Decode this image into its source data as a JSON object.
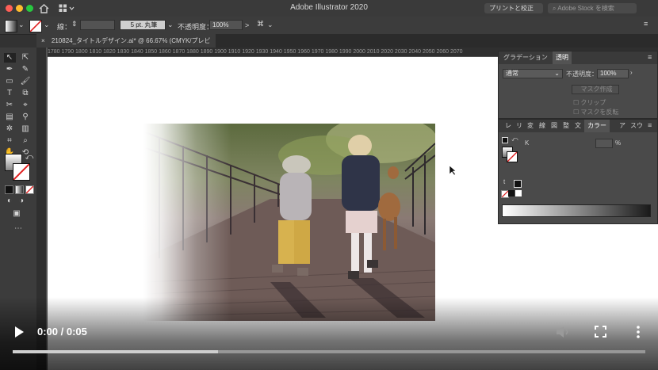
{
  "app": {
    "title": "Adobe Illustrator 2020",
    "workspace_label": "プリントと校正",
    "search_placeholder": "Adobe Stock を検索"
  },
  "control_bar": {
    "stroke_label": "線：",
    "stroke_value": "",
    "brush_value": "5 pt. 丸筆",
    "opacity_label": "不透明度：",
    "opacity_value": "100%",
    "arrow_label": ">"
  },
  "document_tab": {
    "close_glyph": "×",
    "title": "210824_タイトルデザイン.ai* @ 66.67% (CMYK/プレビュー)"
  },
  "ruler": {
    "ticks": "1780 1790 1800 1810 1820 1830 1840 1850 1860 1870 1880 1890 1900 1910 1920 1930 1940 1950 1960 1970 1980 1990 2000 2010 2020 2030 2040 2050 2060 2070"
  },
  "panels": {
    "top": {
      "tabs": [
        "グラデーション",
        "透明"
      ],
      "active_tab": 1,
      "blend_mode": "通常",
      "opacity_label": "不透明度：",
      "opacity_value": "100%",
      "make_mask_label": "マスク作成",
      "clip_label": "クリップ",
      "invert_mask_label": "マスクを反転"
    },
    "bottom": {
      "tabs": [
        "レ",
        "リ",
        "変",
        "線",
        "図",
        "整",
        "文",
        "カラー",
        "ア",
        "スウ"
      ],
      "active_tab": 7,
      "channel_label": "K",
      "channel_value": "",
      "unit": "%"
    }
  },
  "video": {
    "time": "0:00 / 0:05",
    "progress": 0.325,
    "icons": [
      "play-icon",
      "volume-icon",
      "fullscreen-icon",
      "more-icon"
    ]
  },
  "colors": {
    "accent_red": "#ff5f57",
    "accent_yellow": "#febc2e",
    "accent_green": "#28c840"
  }
}
